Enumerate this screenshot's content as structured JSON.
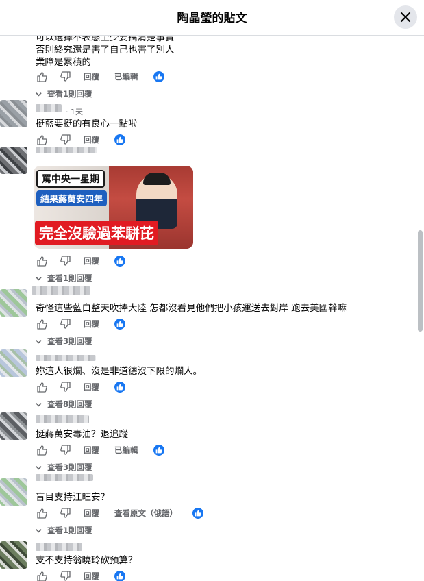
{
  "header": {
    "title": "陶晶瑩的貼文",
    "close_icon": "close-icon"
  },
  "actions": {
    "reply": "回覆",
    "edited": "已編輯",
    "see_original": "查看原文（俄語）"
  },
  "comments": [
    {
      "lines": [
        "可以選擇不表態至少要搞清楚事實",
        "否則終究還是害了自己也害了別人",
        "業障是累積的"
      ],
      "view_replies": "查看1則回覆"
    },
    {
      "time": "1天",
      "text": "挺藍要挺的有良心一點啦"
    },
    {
      "view_replies": "查看1則回覆",
      "image": {
        "caption_top": "罵中央一星期",
        "caption_mid": "結果蔣萬安四年",
        "caption_bottom": "完全沒驗過苯駢芘"
      }
    },
    {
      "text": "奇怪這些藍白整天吹捧大陸 怎都沒看見他們把小孩運送去對岸 跑去美國幹嘛",
      "view_replies": "查看3則回覆"
    },
    {
      "text": "妳這人很爛、沒是非道德沒下限的爛人。",
      "view_replies": "查看8則回覆"
    },
    {
      "text": "挺蔣萬安毒油？退追蹤",
      "view_replies": "查看3則回覆"
    },
    {
      "text": "盲目支持江旺安？",
      "view_replies": "查看1則回覆"
    },
    {
      "text": "支不支持翁曉玲砍預算？"
    }
  ],
  "colors": {
    "accent": "#1877f2",
    "secondary_text": "#65676b",
    "caption_red": "#e11b22",
    "caption_blue": "#1e5fbf"
  }
}
